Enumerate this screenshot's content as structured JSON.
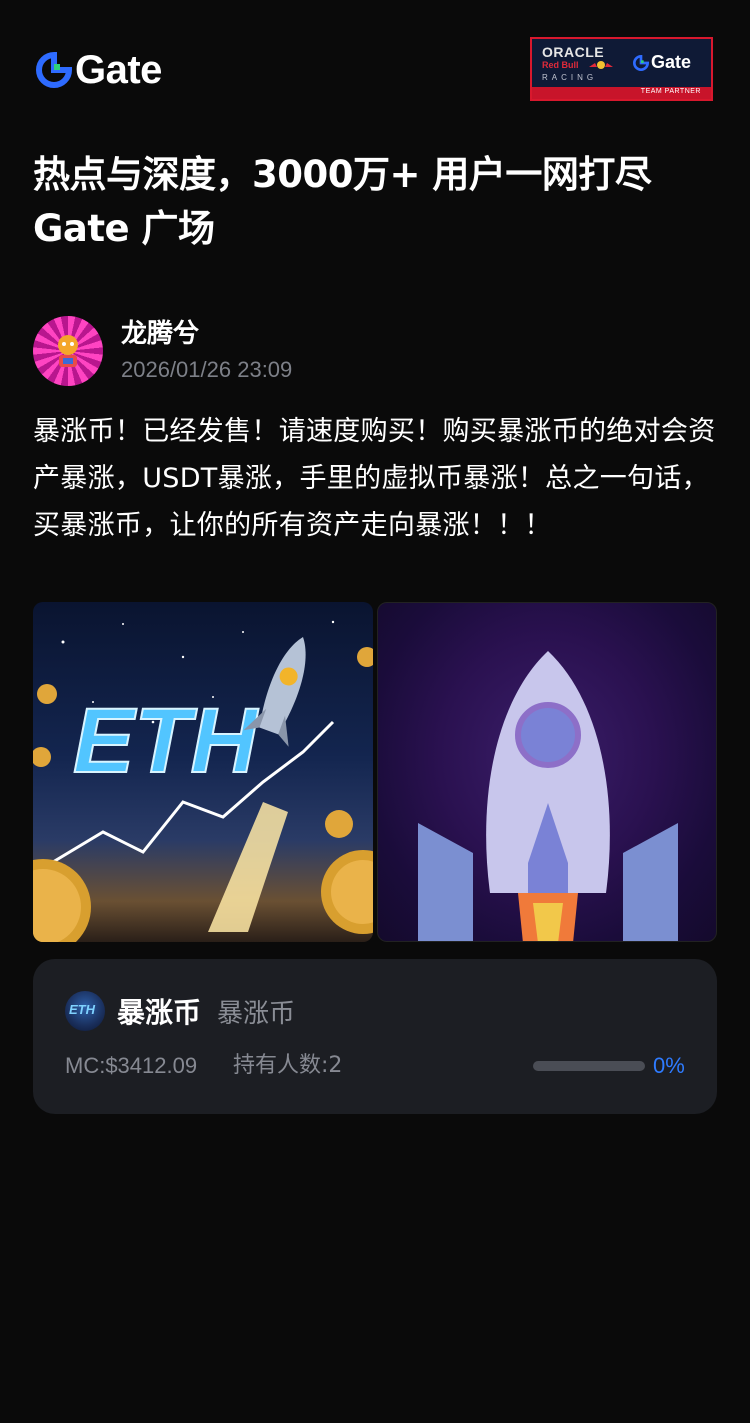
{
  "header": {
    "logo_text": "Gate",
    "partner": {
      "oracle": "ORACLE",
      "red_bull": "Red Bull",
      "racing": "RACING",
      "gate": "Gate",
      "badge": "TEAM PARTNER"
    }
  },
  "headline": {
    "line1": "热点与深度，3000万+ 用户一网打尽",
    "line2": "Gate 广场"
  },
  "post": {
    "author_name": "龙腾兮",
    "timestamp": "2026/01/26 23:09",
    "body": "暴涨币！已经发售！请速度购买！购买暴涨币的绝对会资产暴涨，USDT暴涨，手里的虚拟币暴涨！总之一句话，买暴涨币，让你的所有资产走向暴涨！！！",
    "images": [
      {
        "name": "eth-rocket-image",
        "icon": "eth-rocket-image",
        "text": "ETH"
      },
      {
        "name": "rocket-illustration",
        "icon": "rocket-image"
      }
    ]
  },
  "token": {
    "icon_text": "ETH",
    "name": "暴涨币",
    "symbol": "暴涨币",
    "market_cap": "MC:$3412.09",
    "holders": "持有人数:2",
    "progress_fraction": 0,
    "progress_text": "0%"
  },
  "colors": {
    "background": "#0a0a0a",
    "card": "#1c1e23",
    "accent_blue": "#2e7bff",
    "muted_text": "#868992"
  }
}
